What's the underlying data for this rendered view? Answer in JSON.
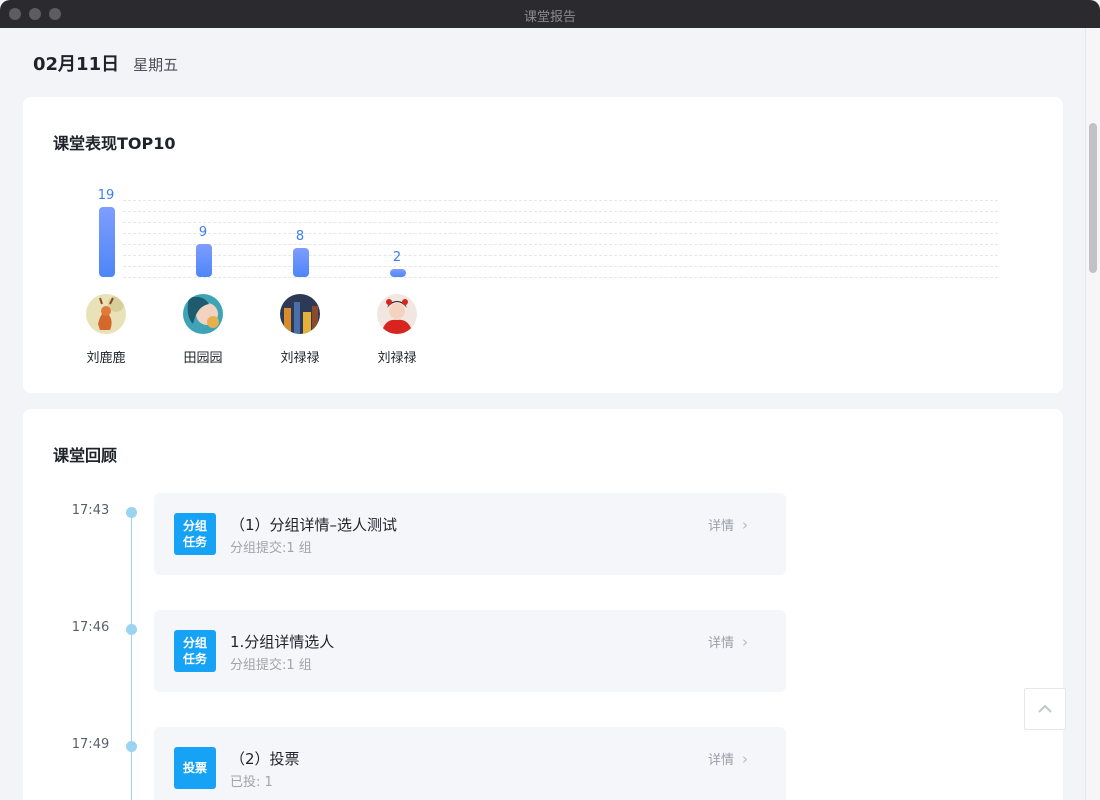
{
  "window": {
    "title": "课堂报告"
  },
  "header": {
    "date": "02月11日",
    "weekday": "星期五"
  },
  "top10": {
    "title": "课堂表现TOP10",
    "chart_data": {
      "type": "bar",
      "categories": [
        "刘鹿鹿",
        "田园园",
        "刘禄禄",
        "刘禄禄"
      ],
      "values": [
        19,
        9,
        8,
        2
      ],
      "title": "",
      "xlabel": "",
      "ylabel": "",
      "ylim": [
        0,
        20
      ],
      "grid": true
    },
    "students": [
      {
        "name": "刘鹿鹿",
        "score": "19",
        "avatar": "deer-avatar"
      },
      {
        "name": "田园园",
        "score": "9",
        "avatar": "girl-illustration-avatar"
      },
      {
        "name": "刘禄禄",
        "score": "8",
        "avatar": "city-night-avatar"
      },
      {
        "name": "刘禄禄",
        "score": "2",
        "avatar": "red-costume-avatar"
      }
    ]
  },
  "review": {
    "title": "课堂回顾",
    "items": [
      {
        "time": "17:43",
        "tag": "分组任务",
        "title": "（1）分组详情–选人测试",
        "sub": "分组提交:1 组",
        "detail": "详情",
        "tag_color": "#16a2f5"
      },
      {
        "time": "17:46",
        "tag": "分组任务",
        "title": "1.分组详情选人",
        "sub": "分组提交:1 组",
        "detail": "详情",
        "tag_color": "#16a2f5"
      },
      {
        "time": "17:49",
        "tag": "投票",
        "title": "（2）投票",
        "sub": "已投: 1",
        "detail": "详情",
        "tag_color": "#16a2f5"
      }
    ]
  },
  "colors": {
    "accent": "#3e7cf6",
    "tag": "#16a2f5",
    "timeline": "#99d4f0"
  },
  "back_to_top": {
    "icon": "chevron-up-icon"
  }
}
